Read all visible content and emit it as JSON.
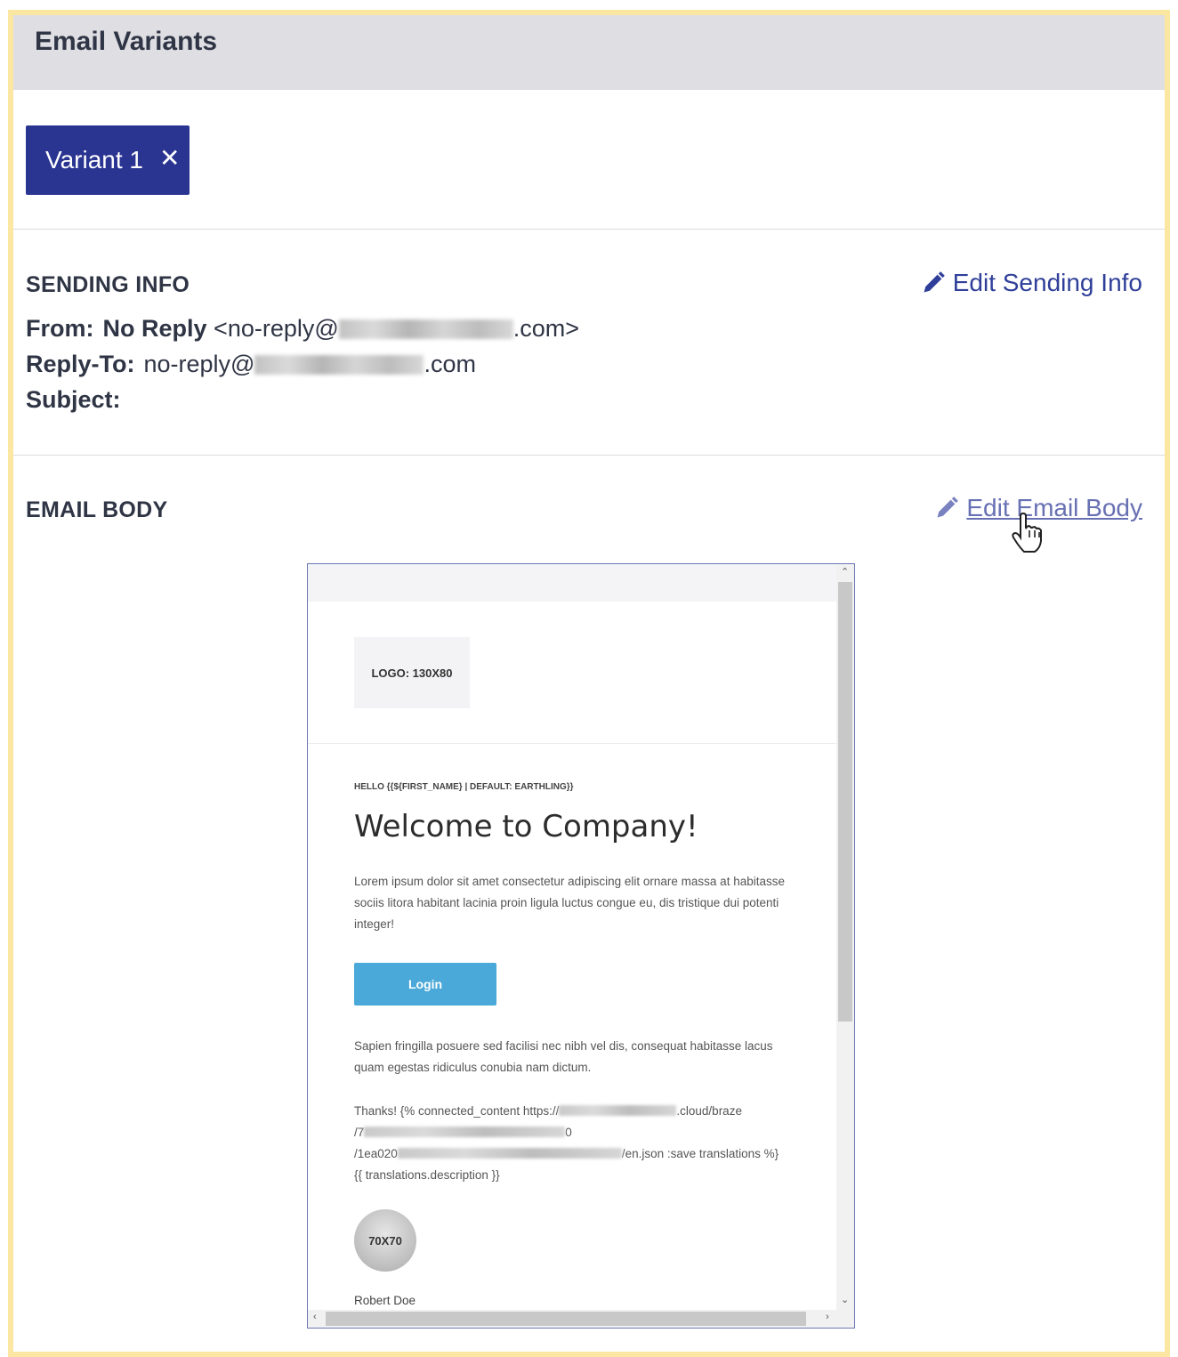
{
  "header": {
    "title": "Email Variants"
  },
  "variants": [
    {
      "label": "Variant 1",
      "remove_icon": "close-icon"
    }
  ],
  "sending_info": {
    "title": "SENDING INFO",
    "edit_label": "Edit Sending Info",
    "from_label": "From:",
    "from_name": "No Reply",
    "from_prefix": "<no-reply@",
    "from_suffix": ".com>",
    "reply_to_label": "Reply-To:",
    "reply_to_prefix": "no-reply@",
    "reply_to_suffix": ".com",
    "subject_label": "Subject:",
    "subject_value": ""
  },
  "email_body": {
    "title": "EMAIL BODY",
    "edit_label": "Edit Email Body",
    "preview": {
      "logo_text": "LOGO: 130X80",
      "greeting": "HELLO {{${FIRST_NAME} | DEFAULT: EARTHLING}}",
      "headline": "Welcome to Company!",
      "paragraph1": "Lorem ipsum dolor sit amet consectetur adipiscing elit ornare massa at habitasse sociis litora habitant lacinia proin ligula luctus congue eu, dis tristique dui potenti integer!",
      "button_label": "Login",
      "paragraph2": "Sapien fringilla posuere sed facilisi nec nibh vel dis, consequat habitasse lacus quam egestas ridiculus conubia nam dictum.",
      "thanks_line1_prefix": "Thanks! {% connected_content https://",
      "thanks_line1_suffix": ".cloud/braze",
      "thanks_line2_prefix": "/7",
      "thanks_line2_suffix": "0",
      "thanks_line3_prefix": "/1ea020",
      "thanks_line3_suffix": "/en.json :save translations %}",
      "thanks_line4": "{{ translations.description }}",
      "avatar_text": "70X70",
      "signature_name": "Robert Doe"
    }
  },
  "colors": {
    "frame": "#fbe7a2",
    "header_bg": "#dedee3",
    "primary": "#2a3592",
    "link": "#2f3f99",
    "button": "#4aa9d8"
  }
}
